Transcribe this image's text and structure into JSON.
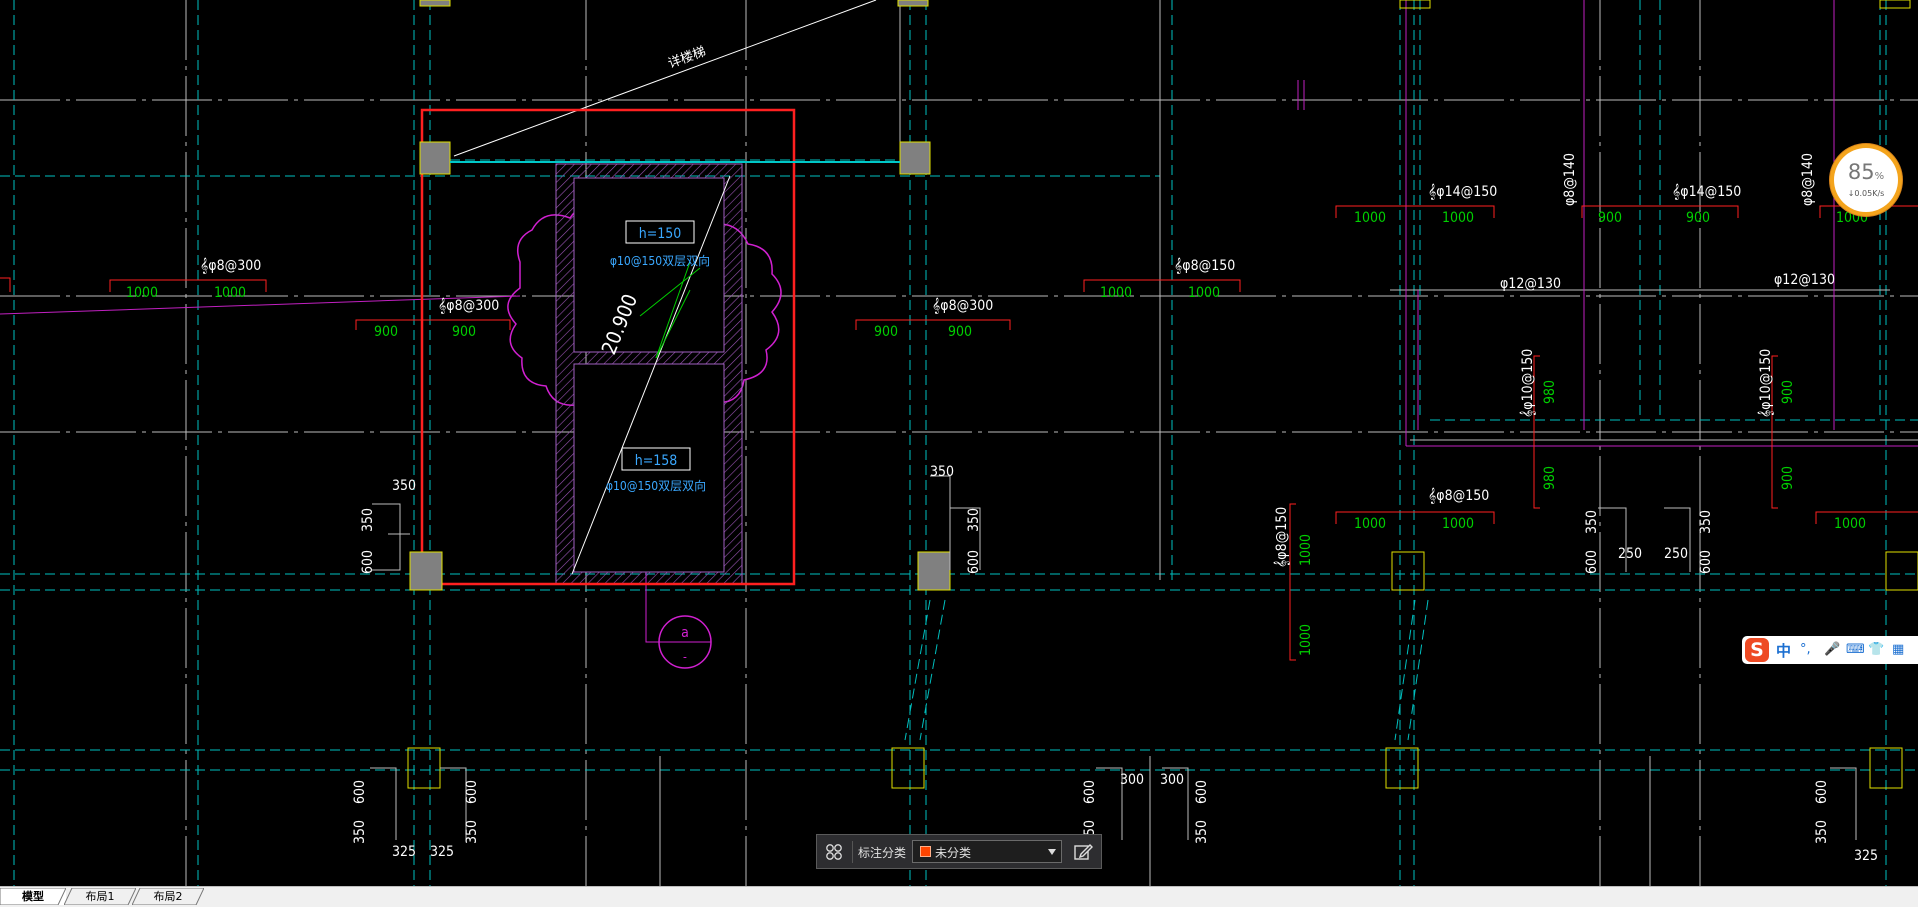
{
  "drawing": {
    "labels": {
      "stair_note": "详楼梯",
      "h1": "h=150",
      "h2": "h=158",
      "rebar_box": "φ10@150双层双向",
      "elevation": "20.900",
      "axis_id": "a",
      "axis_sub": "-",
      "l_8_300": "𝄞φ8@300",
      "l_8_300_b": "𝄞φ8@300",
      "l_8_300_c": "𝄞φ8@300",
      "l_8_150_a": "𝄞φ8@150",
      "l_8_150_b": "𝄞φ8@150",
      "l_8_150_c": "𝄞φ8@150",
      "l_14_150_a": "𝄞φ14@150",
      "l_14_150_b": "𝄞φ14@150",
      "l_10_150_a": "𝄞φ10@150",
      "l_10_150_b": "𝄞φ10@150",
      "l_8_140_a": "φ8@140",
      "l_8_140_b": "φ8@140",
      "l_12_130_a": "φ12@130",
      "l_12_130_b": "φ12@130",
      "d1000": "1000",
      "d900": "900",
      "d980": "980",
      "d350": "350",
      "d600": "600",
      "d250": "250",
      "d325": "325",
      "d300": "300"
    }
  },
  "annotation_toolbar": {
    "label": "标注分类",
    "selected": "未分类",
    "swatch_color": "#ff4500"
  },
  "speed_widget": {
    "percent": "85",
    "percent_sign": "%",
    "rate": "↓0.05K/s"
  },
  "ime": {
    "lang": "中",
    "logo": "S"
  },
  "tabs": [
    {
      "label": "模型",
      "active": true
    },
    {
      "label": "布局1",
      "active": false
    },
    {
      "label": "布局2",
      "active": false
    }
  ],
  "colors": {
    "grid_white": "#bfbfbf",
    "cyan": "#00c8c8",
    "magenta": "#d020d0",
    "red": "#ff2020",
    "green": "#00d000",
    "yellow": "#e0e000",
    "blue_text": "#3aa8ff"
  }
}
